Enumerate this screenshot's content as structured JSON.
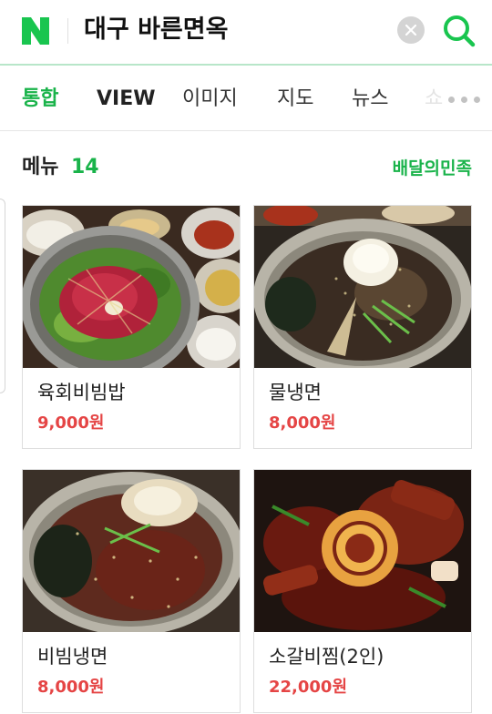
{
  "header": {
    "logo_text": "N",
    "query": "대구 바른면옥",
    "clear_icon": "close-icon",
    "search_icon": "search-icon"
  },
  "tabs": [
    {
      "label": "통합",
      "active": true
    },
    {
      "label": "VIEW",
      "active": false
    },
    {
      "label": "이미지",
      "active": false
    },
    {
      "label": "지도",
      "active": false
    },
    {
      "label": "뉴스",
      "active": false
    },
    {
      "label": "쇼",
      "active": false
    }
  ],
  "more_icon": "more-dots-icon",
  "menu_section": {
    "title": "메뉴",
    "count": "14",
    "link": "배달의민족",
    "items": [
      {
        "name": "육회비빔밥",
        "price": "9,000원"
      },
      {
        "name": "물냉면",
        "price": "8,000원"
      },
      {
        "name": "비빔냉면",
        "price": "8,000원"
      },
      {
        "name": "소갈비찜(2인)",
        "price": "22,000원"
      }
    ]
  },
  "colors": {
    "brand_green": "#19b34a",
    "price_red": "#e54545"
  }
}
